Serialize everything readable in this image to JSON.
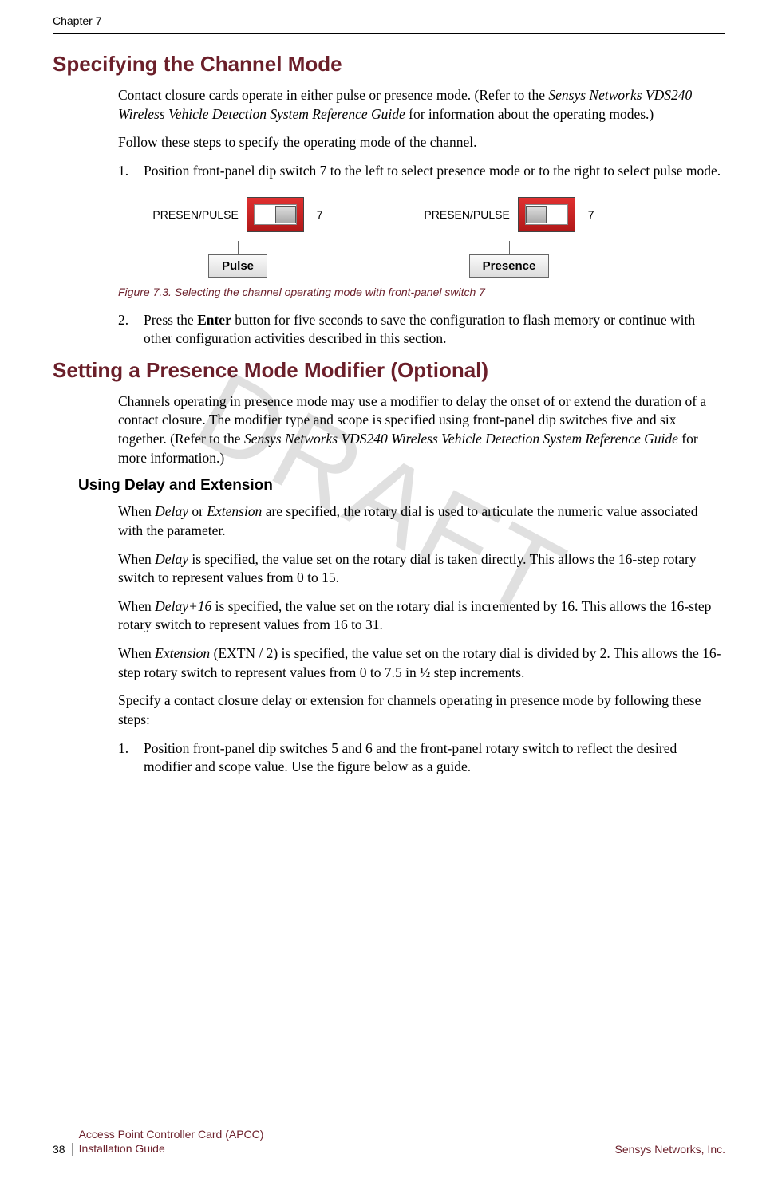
{
  "header": {
    "chapter": "Chapter 7"
  },
  "watermark": "DRAFT",
  "sections": {
    "s1": {
      "title": "Specifying the Channel Mode",
      "p1a": "Contact closure cards operate in either pulse or presence mode. (Refer to the ",
      "p1b": "Sensys Networks VDS240 Wireless Vehicle Detection System Reference Guide",
      "p1c": " for information about the operating modes.)",
      "p2": "Follow these steps to specify the operating mode of the channel.",
      "li1_num": "1.",
      "li1": "Position front-panel dip switch 7 to the left to select presence mode or to the right to select pulse mode.",
      "figure": {
        "switch_label": "PRESEN/PULSE",
        "switch_num": "7",
        "tag_pulse": "Pulse",
        "tag_presence": "Presence",
        "caption": "Figure 7.3. Selecting the channel operating mode with front-panel switch 7"
      },
      "li2_num": "2.",
      "li2a": "Press the ",
      "li2b": "Enter",
      "li2c": " button for five seconds to save the configuration to flash memory or continue with other configuration activities described in this section."
    },
    "s2": {
      "title": "Setting a Presence Mode Modifier (Optional)",
      "p1a": "Channels operating in presence mode may use a modifier to delay the onset of or extend the duration of a contact closure. The modifier type and scope is specified using front-panel dip switches five and six together. (Refer to the ",
      "p1b": "Sensys Networks VDS240 Wireless Vehicle Detection System Reference Guide",
      "p1c": " for more information.)",
      "sub": {
        "title": "Using Delay and Extension",
        "p1a": "When ",
        "p1b": "Delay",
        "p1c": " or ",
        "p1d": "Extension",
        "p1e": " are specified, the rotary dial is used to articulate the numeric value associated with the parameter.",
        "p2a": "When ",
        "p2b": "Delay",
        "p2c": " is specified, the value set on the rotary dial is taken directly. This allows the 16-step rotary switch to represent values from 0 to 15.",
        "p3a": "When ",
        "p3b": "Delay+16",
        "p3c": " is specified, the value set on the rotary dial is incremented by 16. This allows the 16-step rotary switch to represent values from 16 to 31.",
        "p4a": "When ",
        "p4b": "Extension",
        "p4c": " (EXTN / 2) is specified, the value set on the rotary dial is divided by 2. This allows the 16-step rotary switch to represent values from 0 to 7.5 in ½ step increments.",
        "p5": "Specify a contact closure delay or extension for channels operating in presence mode by following these steps:",
        "li1_num": "1.",
        "li1": "Position front-panel dip switches 5 and 6 and the front-panel rotary switch to reflect the desired modifier and scope value. Use the figure below as a guide."
      }
    }
  },
  "footer": {
    "page": "38",
    "title_line1": "Access Point Controller Card (APCC)",
    "title_line2": "Installation Guide",
    "company": "Sensys Networks, Inc."
  }
}
